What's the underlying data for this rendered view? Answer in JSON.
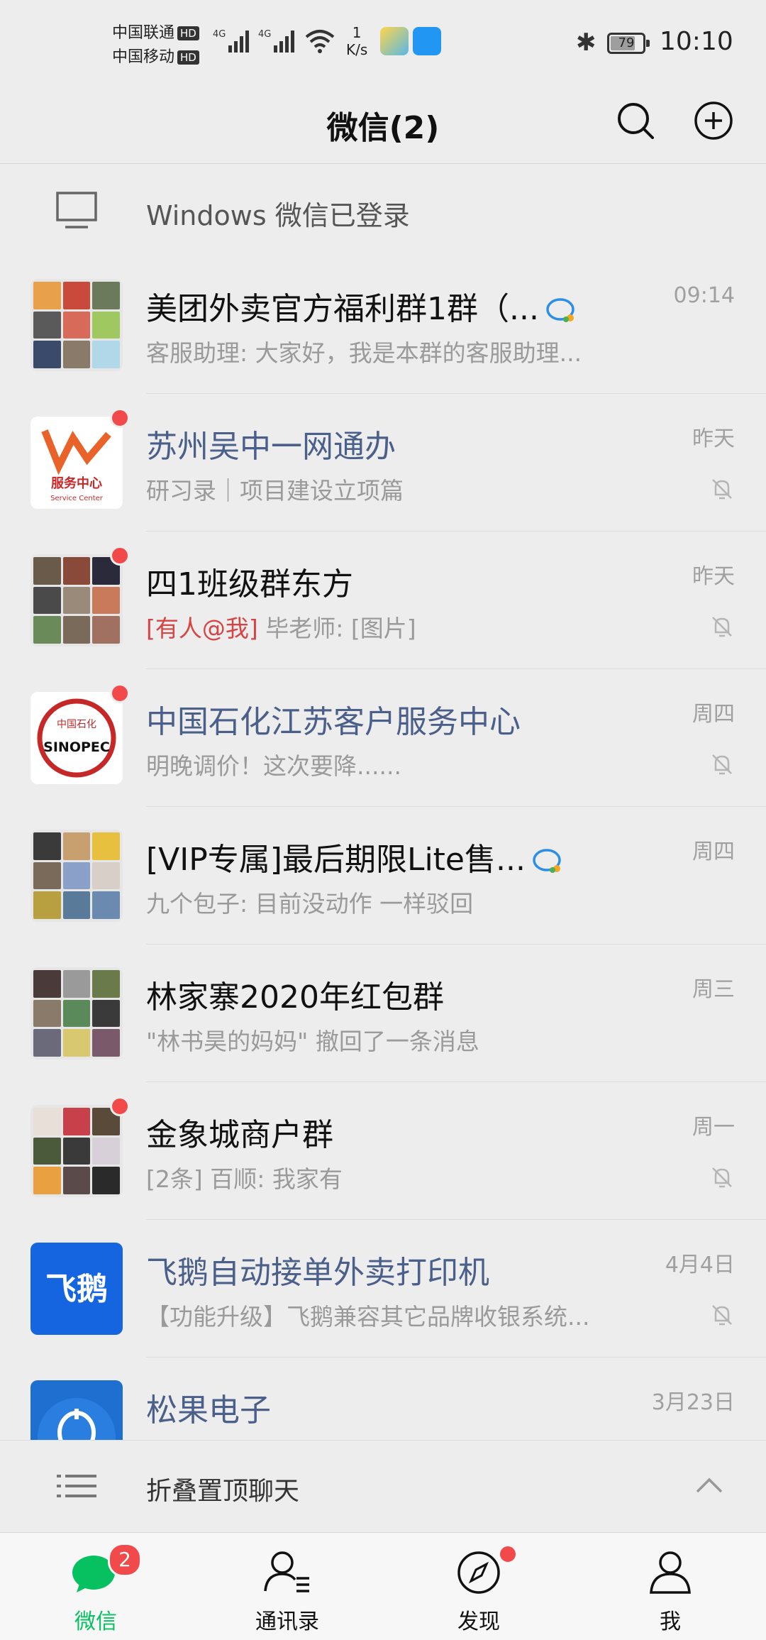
{
  "status_bar": {
    "carrier1": "中国联通",
    "carrier2": "中国移动",
    "hd": "HD",
    "net1": "4G",
    "net2": "4G",
    "speed_value": "1",
    "speed_unit": "K/s",
    "battery": "79",
    "battery_level": 0.79,
    "time": "10:10"
  },
  "header": {
    "title": "微信(2)",
    "search_icon": "search-icon",
    "add_icon": "plus-circle-icon"
  },
  "windows_bar": {
    "icon": "monitor-icon",
    "label": "Windows 微信已登录"
  },
  "chats": [
    {
      "name": "美团外卖官方福利群1群（...",
      "preview": "客服助理: 大家好，我是本群的客服助理...",
      "time": "09:14",
      "blue": false,
      "unread_dot": false,
      "muted": false,
      "group_icon": true
    },
    {
      "name": "苏州吴中一网通办",
      "preview": "研习录｜项目建设立项篇",
      "time": "昨天",
      "blue": true,
      "unread_dot": true,
      "muted": true,
      "avatar_text": "服务中心",
      "avatar_sub": "Service Center"
    },
    {
      "name": "四1班级群东方",
      "preview_at": "[有人@我]",
      "preview": " 毕老师: [图片]",
      "time": "昨天",
      "blue": false,
      "unread_dot": true,
      "muted": true
    },
    {
      "name": "中国石化江苏客户服务中心",
      "preview": "明晚调价！这次要降......",
      "time": "周四",
      "blue": true,
      "unread_dot": true,
      "muted": true,
      "avatar_text": "SINOPEC",
      "avatar_sub": "中国石化"
    },
    {
      "name": "[VIP专属]最后期限Lite售...",
      "preview": "九个包子: 目前没动作  一样驳回",
      "time": "周四",
      "blue": false,
      "unread_dot": false,
      "muted": false,
      "group_icon": true
    },
    {
      "name": "林家寨2020年红包群",
      "preview": "\"林书昊的妈妈\" 撤回了一条消息",
      "time": "周三",
      "blue": false,
      "unread_dot": false,
      "muted": false
    },
    {
      "name": "金象城商户群",
      "preview": "[2条] 百顺: 我家有",
      "time": "周一",
      "blue": false,
      "unread_dot": true,
      "muted": true
    },
    {
      "name": "飞鹅自动接单外卖打印机",
      "preview": "【功能升级】飞鹅兼容其它品牌收银系统...",
      "time": "4月4日",
      "blue": true,
      "unread_dot": false,
      "muted": true,
      "avatar_text": "飞鹅"
    },
    {
      "name": "松果电子",
      "preview": "",
      "time": "3月23日",
      "blue": true,
      "unread_dot": false,
      "muted": true
    }
  ],
  "fold_bar": {
    "label": "折叠置顶聊天",
    "icon": "list-icon",
    "chevron": "chevron-up-icon"
  },
  "tabs": [
    {
      "label": "微信",
      "icon": "chat-bubble-icon",
      "badge": "2",
      "active": true
    },
    {
      "label": "通讯录",
      "icon": "contacts-icon",
      "active": false
    },
    {
      "label": "发现",
      "icon": "compass-icon",
      "dot": true,
      "active": false
    },
    {
      "label": "我",
      "icon": "person-icon",
      "active": false
    }
  ],
  "colors": {
    "accent": "#07c160",
    "unread": "#f24a4a",
    "official_name": "#4a5f8a",
    "mention": "#d64545"
  }
}
